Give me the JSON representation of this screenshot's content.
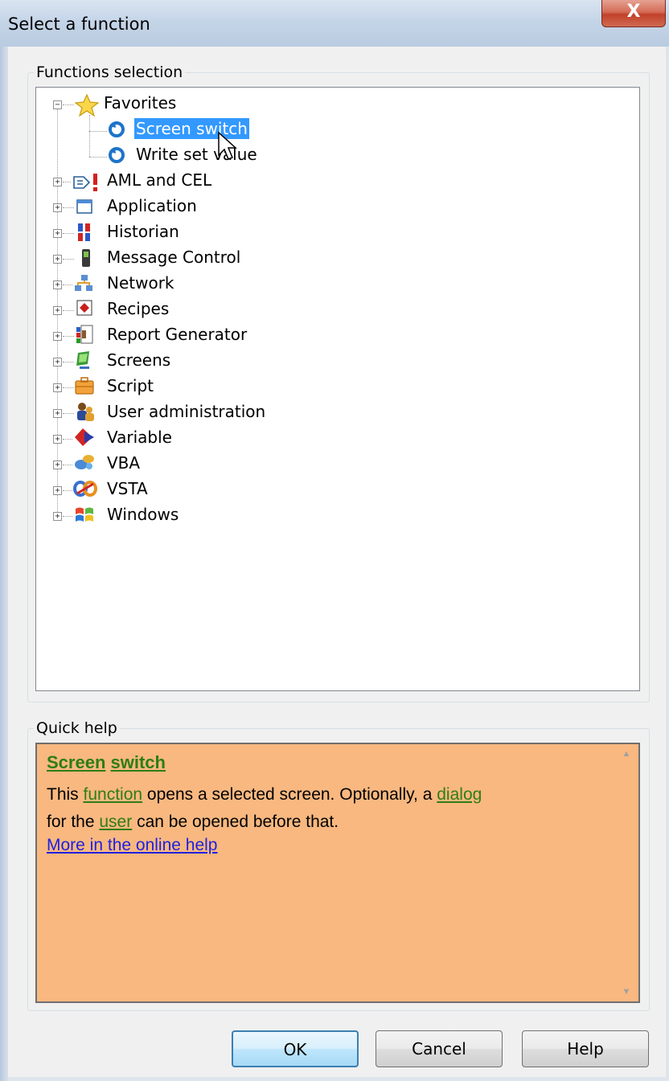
{
  "window": {
    "title": "Select a function",
    "close_glyph": "X"
  },
  "functions_selection": {
    "label": "Functions selection",
    "tree": [
      {
        "label": "Favorites",
        "icon": "star-icon",
        "expanded": true,
        "children": [
          {
            "label": "Screen switch",
            "icon": "function-icon",
            "selected": true
          },
          {
            "label": "Write set value",
            "icon": "function-icon"
          }
        ]
      },
      {
        "label": "AML and CEL",
        "icon": "alarm-icon"
      },
      {
        "label": "Application",
        "icon": "application-window-icon"
      },
      {
        "label": "Historian",
        "icon": "historian-icon"
      },
      {
        "label": "Message Control",
        "icon": "mobile-phone-icon"
      },
      {
        "label": "Network",
        "icon": "network-icon"
      },
      {
        "label": "Recipes",
        "icon": "recipe-icon"
      },
      {
        "label": "Report Generator",
        "icon": "report-icon"
      },
      {
        "label": "Screens",
        "icon": "screen-icon"
      },
      {
        "label": "Script",
        "icon": "script-icon"
      },
      {
        "label": "User administration",
        "icon": "users-icon"
      },
      {
        "label": "Variable",
        "icon": "variable-icon"
      },
      {
        "label": "VBA",
        "icon": "vba-icon"
      },
      {
        "label": "VSTA",
        "icon": "vsta-icon"
      },
      {
        "label": "Windows",
        "icon": "windows-logo-icon"
      }
    ]
  },
  "quick_help": {
    "label": "Quick help",
    "title_word_1": "Screen",
    "title_word_2": "switch",
    "text_1": "This ",
    "term_function": "function",
    "text_2": " opens a selected screen. Optionally, a ",
    "term_dialog": "dialog",
    "text_3": " for the ",
    "term_user": "user",
    "text_4": " can be opened before that.",
    "online_help_link": "More in the online help",
    "background_color": "#f8b880",
    "term_color": "#2f7d15"
  },
  "buttons": {
    "ok": "OK",
    "cancel": "Cancel",
    "help": "Help"
  }
}
